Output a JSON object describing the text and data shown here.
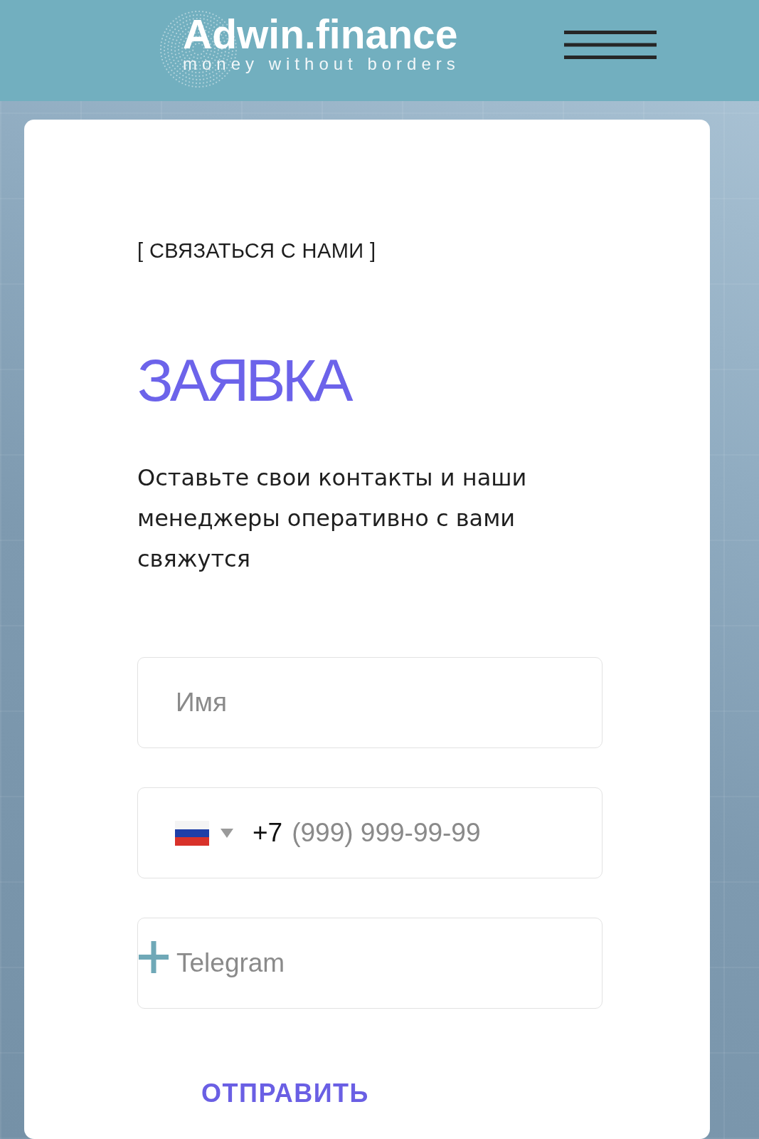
{
  "header": {
    "logo": {
      "title": "Adwin.finance",
      "tagline": "money without borders"
    }
  },
  "contact_form": {
    "eyebrow": "[ СВЯЗАТЬСЯ С НАМИ ]",
    "title": "ЗАЯВКА",
    "description": "Оставьте свои контакты и наши менеджеры оперативно с вами свяжутся",
    "fields": [
      {
        "kind": "text",
        "placeholder": "Имя"
      },
      {
        "kind": "phone",
        "country_code": "+7",
        "placeholder": "(999) 999-99-99"
      },
      {
        "kind": "messenger",
        "placeholder": "Telegram"
      }
    ],
    "submit": "ОТПРАВИТЬ"
  }
}
